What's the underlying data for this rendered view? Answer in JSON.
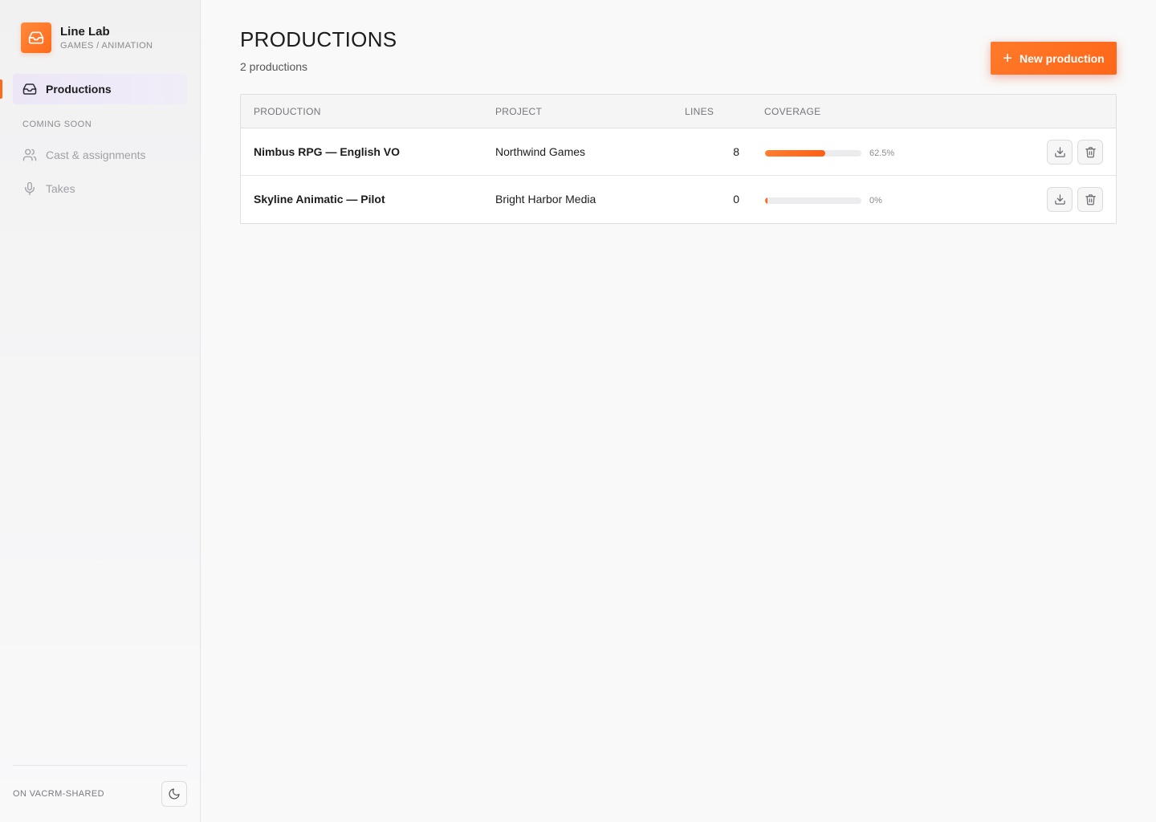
{
  "brand": {
    "name": "Line Lab",
    "subtitle": "GAMES / ANIMATION",
    "logo_icon": "inbox-icon",
    "accent": "#ff6a1a"
  },
  "sidebar": {
    "active_item": {
      "label": "Productions",
      "icon": "inbox-icon"
    },
    "section_label": "COMING SOON",
    "items": [
      {
        "label": "Cast & assignments",
        "icon": "users-icon",
        "disabled": true
      },
      {
        "label": "Takes",
        "icon": "microphone-icon",
        "disabled": true
      }
    ],
    "footer_text": "ON VACRM-SHARED",
    "theme_toggle_icon": "moon-icon"
  },
  "main": {
    "title": "PRODUCTIONS",
    "count_text": "2 productions",
    "new_button_label": "New production",
    "table": {
      "columns": [
        "PRODUCTION",
        "PROJECT",
        "LINES",
        "COVERAGE"
      ],
      "rows": [
        {
          "production": "Nimbus RPG — English VO",
          "project": "Northwind Games",
          "lines": "8",
          "coverage_text": "62.5%",
          "coverage_value": 0.625
        },
        {
          "production": "Skyline Animatic — Pilot",
          "project": "Bright Harbor Media",
          "lines": "0",
          "coverage_text": "0%",
          "coverage_value": 0
        }
      ],
      "row_action_icons": [
        "download-icon",
        "trash-icon"
      ]
    }
  }
}
